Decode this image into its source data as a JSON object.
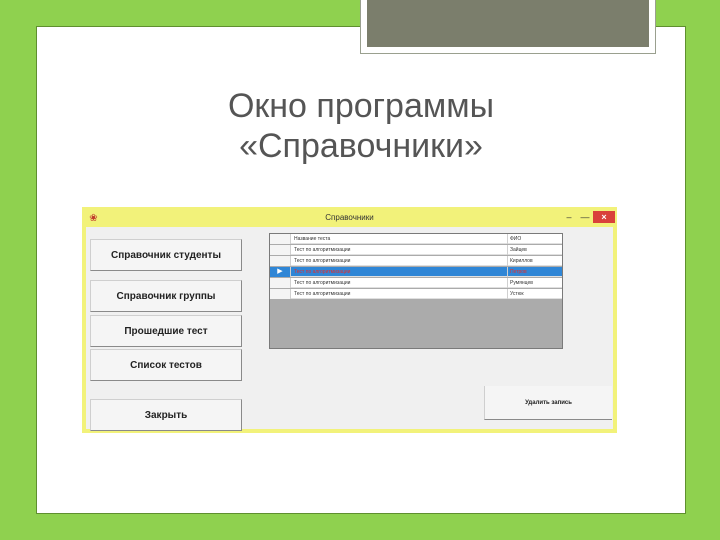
{
  "slide": {
    "title_line1": "Окно программы",
    "title_line2": "«Справочники»"
  },
  "window": {
    "title": "Справочники",
    "controls": {
      "minimize": "–",
      "maximize": "—",
      "close": "×"
    },
    "titlebar_color": "#f2f27a",
    "buttons": [
      {
        "label": "Справочник студенты"
      },
      {
        "label": "Справочник группы"
      },
      {
        "label": "Прошедшие тест"
      },
      {
        "label": "Список тестов"
      },
      {
        "label": "Закрыть"
      }
    ],
    "delete_button": "Удалить запись",
    "grid": {
      "selection_color": "#2f86d6",
      "rows": [
        {
          "test": "Название теста",
          "fio": "ФИО",
          "selected": false
        },
        {
          "test": "Тест по алгоритмизации",
          "fio": "Зайцев",
          "selected": false
        },
        {
          "test": "Тест по алгоритмизации",
          "fio": "Кириллов",
          "selected": false
        },
        {
          "test": "Тест по алгоритмизации",
          "fio": "Петров",
          "selected": true
        },
        {
          "test": "Тест по алгоритмизации",
          "fio": "Румянцев",
          "selected": false
        },
        {
          "test": "Тест по алгоритмизации",
          "fio": "Устюк",
          "selected": false
        }
      ]
    }
  }
}
